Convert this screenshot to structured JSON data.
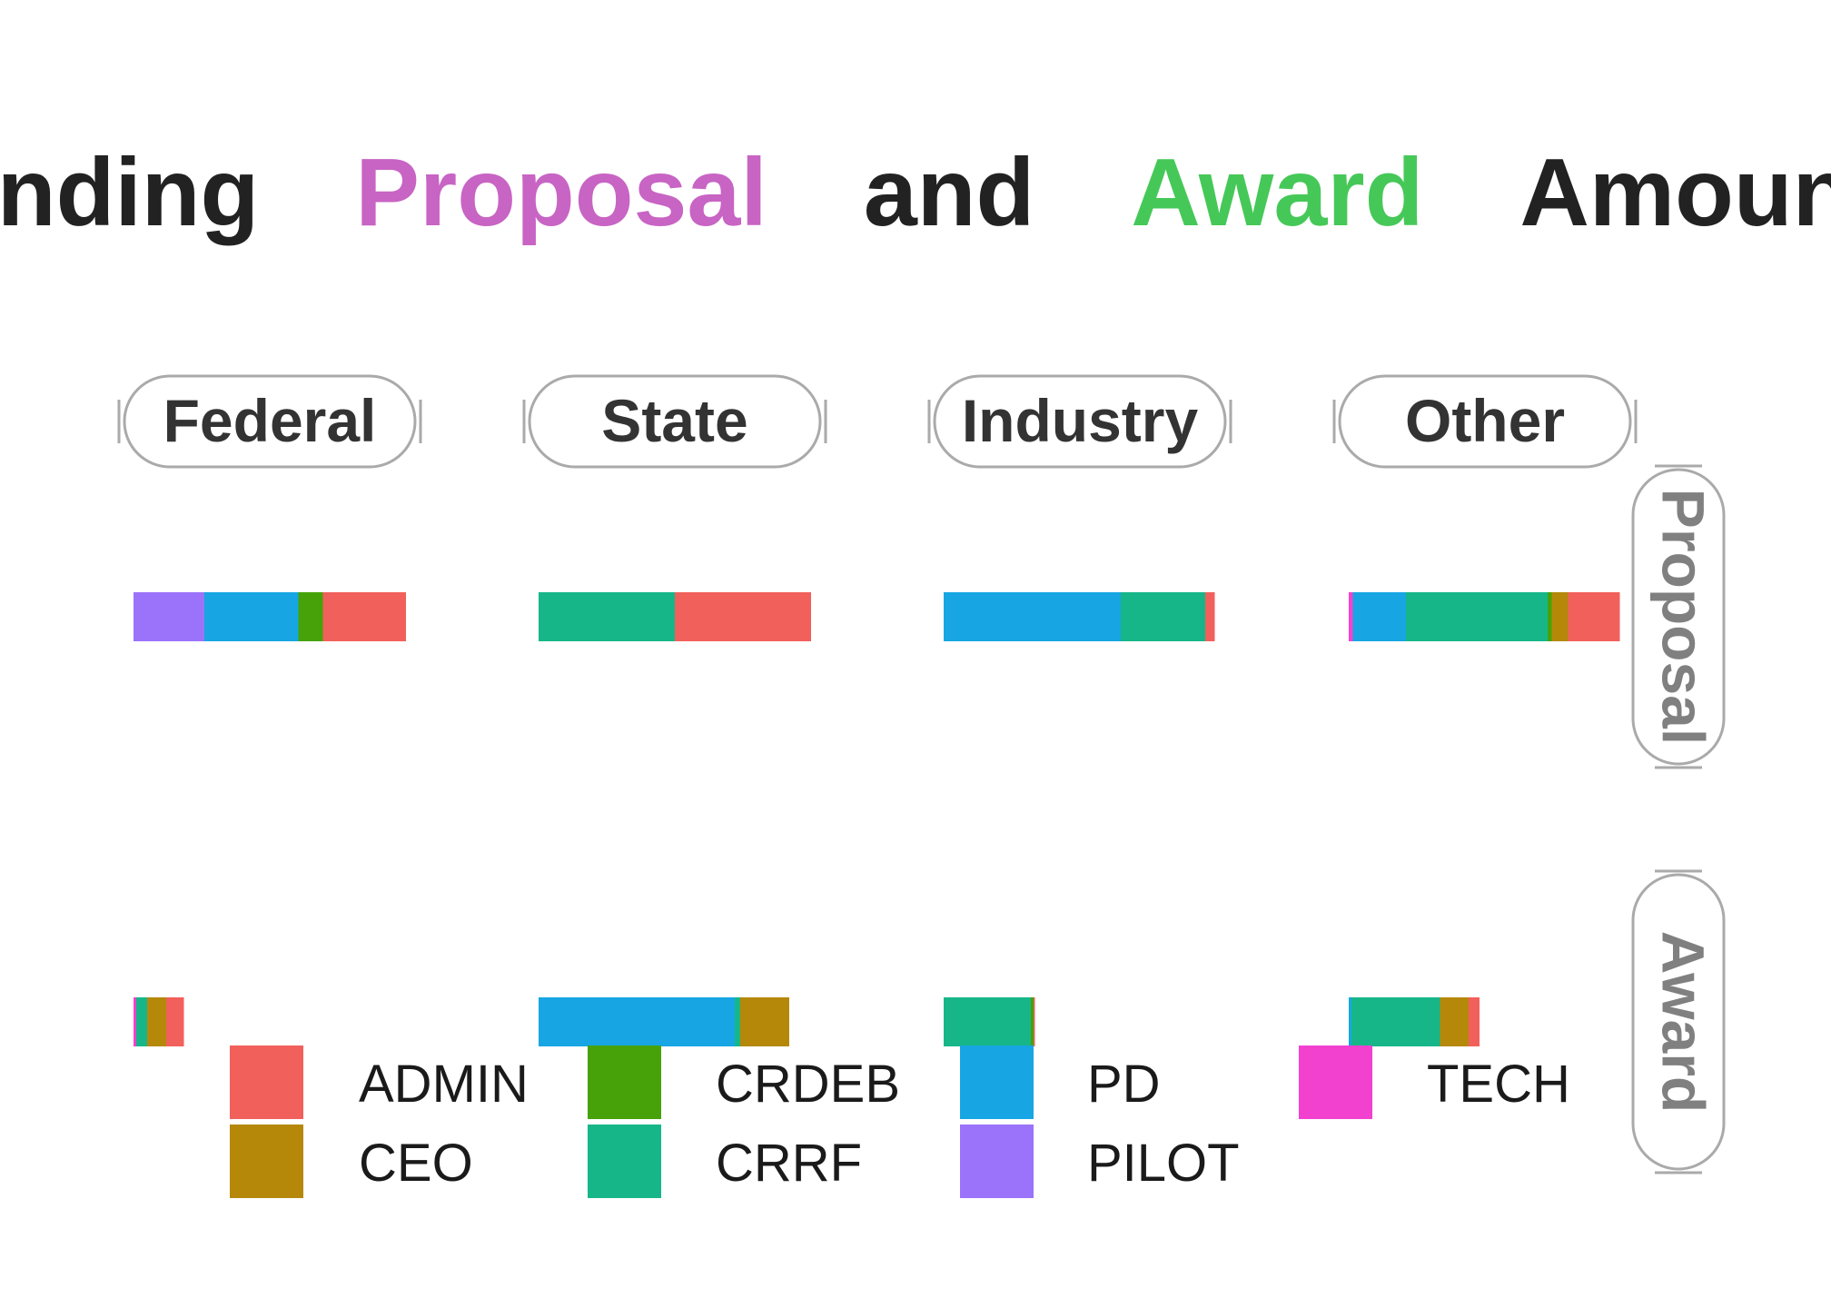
{
  "chart_data": {
    "type": "bar",
    "orientation": "horizontal-stacked",
    "title_parts": [
      {
        "text": "Funding",
        "color": "#222222"
      },
      {
        "text": "Proposal",
        "color": "#C864C4"
      },
      {
        "text": "and",
        "color": "#222222"
      },
      {
        "text": "Award",
        "color": "#46C858"
      },
      {
        "text": "Amounts",
        "color": "#222222"
      }
    ],
    "columns": [
      "Federal",
      "State",
      "Industry",
      "Other"
    ],
    "rows": [
      "Proposal",
      "Award"
    ],
    "x_range": [
      0,
      100
    ],
    "categories": [
      "PILOT",
      "TECH",
      "PD",
      "CRRF",
      "CRDEB",
      "CEO",
      "ADMIN"
    ],
    "colors": {
      "ADMIN": "#F2605C",
      "CEO": "#B5880A",
      "CRDEB": "#46A208",
      "CRRF": "#17B689",
      "PD": "#17A6E3",
      "PILOT": "#9A73FA",
      "TECH": "#F341CF"
    },
    "panels": [
      {
        "column": "Federal",
        "row": "Proposal",
        "segments": [
          {
            "category": "PILOT",
            "value": 26
          },
          {
            "category": "PD",
            "value": 34.5
          },
          {
            "category": "CRDEB",
            "value": 9
          },
          {
            "category": "ADMIN",
            "value": 30.5
          }
        ]
      },
      {
        "column": "State",
        "row": "Proposal",
        "segments": [
          {
            "category": "CRRF",
            "value": 50
          },
          {
            "category": "ADMIN",
            "value": 50
          }
        ]
      },
      {
        "column": "Industry",
        "row": "Proposal",
        "segments": [
          {
            "category": "PD",
            "value": 65
          },
          {
            "category": "CRRF",
            "value": 31
          },
          {
            "category": "ADMIN",
            "value": 3.5
          }
        ]
      },
      {
        "column": "Other",
        "row": "Proposal",
        "segments": [
          {
            "category": "TECH",
            "value": 1.5
          },
          {
            "category": "PD",
            "value": 19.5
          },
          {
            "category": "CRRF",
            "value": 52
          },
          {
            "category": "CRDEB",
            "value": 1.5
          },
          {
            "category": "CEO",
            "value": 6
          },
          {
            "category": "ADMIN",
            "value": 19
          }
        ]
      },
      {
        "column": "Federal",
        "row": "Award",
        "segments": [
          {
            "category": "TECH",
            "value": 1
          },
          {
            "category": "CRRF",
            "value": 4
          },
          {
            "category": "CEO",
            "value": 7
          },
          {
            "category": "ADMIN",
            "value": 6.5
          }
        ]
      },
      {
        "column": "State",
        "row": "Award",
        "segments": [
          {
            "category": "PD",
            "value": 72
          },
          {
            "category": "CRRF",
            "value": 2
          },
          {
            "category": "CEO",
            "value": 18
          }
        ]
      },
      {
        "column": "Industry",
        "row": "Award",
        "segments": [
          {
            "category": "CRRF",
            "value": 32
          },
          {
            "category": "CRDEB",
            "value": 1
          },
          {
            "category": "ADMIN",
            "value": 0.5
          }
        ]
      },
      {
        "column": "Other",
        "row": "Award",
        "segments": [
          {
            "category": "PD",
            "value": 1
          },
          {
            "category": "CRRF",
            "value": 32.5
          },
          {
            "category": "CEO",
            "value": 10.5
          },
          {
            "category": "ADMIN",
            "value": 4
          }
        ]
      }
    ],
    "legend": {
      "position": "bottom",
      "items": [
        "ADMIN",
        "CRDEB",
        "PD",
        "TECH",
        "CEO",
        "CRRF",
        "PILOT"
      ]
    },
    "grid": false,
    "axes_visible": false
  }
}
